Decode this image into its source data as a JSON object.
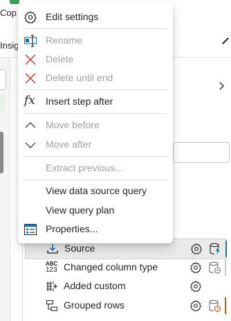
{
  "background": {
    "ribbon_label_1": "Cop",
    "ribbon_label_2": "Insig"
  },
  "context_menu": {
    "items": [
      {
        "label": "Edit settings",
        "icon": "gear-icon",
        "enabled": true
      },
      {
        "label": "Rename",
        "icon": "rename-icon",
        "enabled": false
      },
      {
        "label": "Delete",
        "icon": "delete-icon",
        "enabled": false
      },
      {
        "label": "Delete until end",
        "icon": "delete-icon",
        "enabled": false
      },
      {
        "label": "Insert step after",
        "icon": "fx-icon",
        "enabled": true
      },
      {
        "label": "Move before",
        "icon": "chevron-up-icon",
        "enabled": false
      },
      {
        "label": "Move after",
        "icon": "chevron-down-icon",
        "enabled": false
      },
      {
        "label": "Extract previous...",
        "icon": "",
        "enabled": false
      },
      {
        "label": "View data source query",
        "icon": "",
        "enabled": true
      },
      {
        "label": "View query plan",
        "icon": "",
        "enabled": true
      },
      {
        "label": "Properties...",
        "icon": "properties-icon",
        "enabled": true
      }
    ]
  },
  "applied_steps": [
    {
      "label": "Source",
      "icon": "source-icon",
      "selected": true,
      "status": "lightning-database-icon"
    },
    {
      "label": "Changed column type",
      "icon": "abc-123-icon",
      "abc": "ABC",
      "num": "123",
      "selected": false,
      "status": "database-pending-icon"
    },
    {
      "label": "Added custom",
      "icon": "add-column-icon",
      "selected": false,
      "status": ""
    },
    {
      "label": "Grouped rows",
      "icon": "group-rows-icon",
      "selected": false,
      "status": "database-clock-icon"
    }
  ],
  "colors": {
    "delete_red": "#d13438",
    "step_bar_teal": "#0f7b8a",
    "step_bar_orange": "#c55a11",
    "disabled_text": "#a0a0a0"
  }
}
